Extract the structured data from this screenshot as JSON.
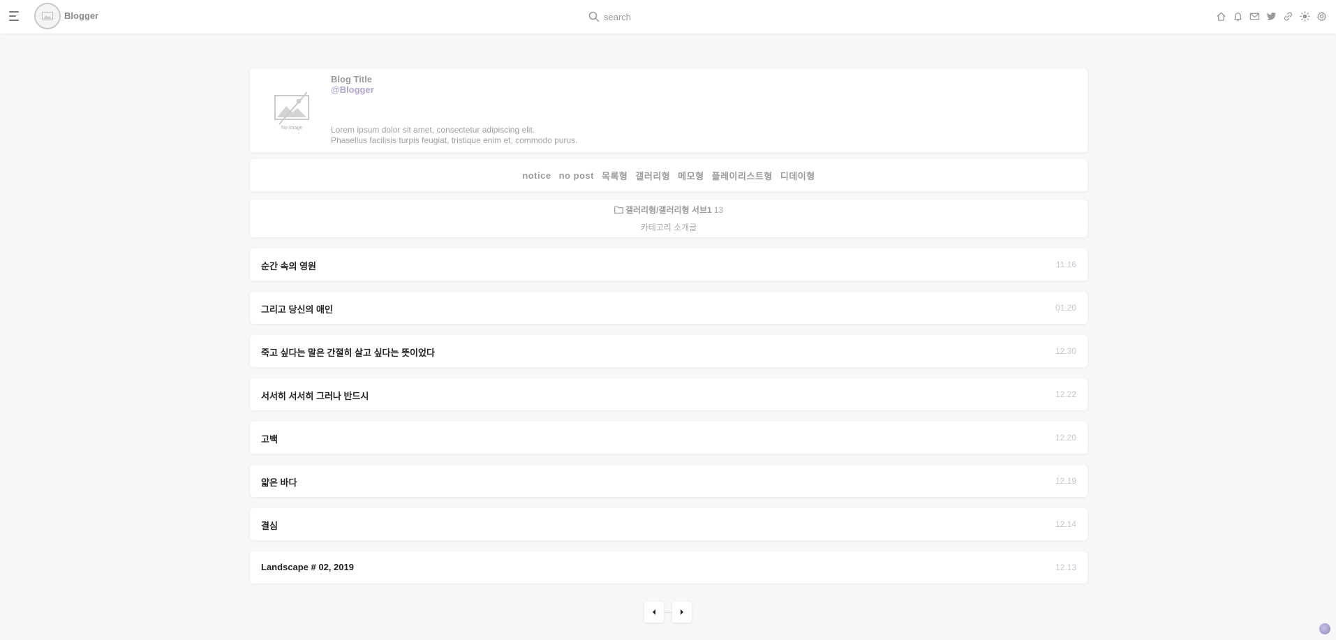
{
  "header": {
    "brand": "Blogger",
    "search_placeholder": "search",
    "icons": [
      "home-icon",
      "bell-icon",
      "mail-icon",
      "twitter-icon",
      "link-icon",
      "sun-icon",
      "gear-icon"
    ]
  },
  "profile": {
    "title": "Blog Title",
    "handle": "@Blogger",
    "no_image_label": "No Image",
    "desc_line1": "Lorem ipsum dolor sit amet, consectetur adipiscing elit.",
    "desc_line2": "Phasellus facilisis turpis feugiat, tristique enim et, commodo purus."
  },
  "categories": [
    "notice",
    "no post",
    "목록형",
    "갤러리형",
    "메모형",
    "플레이리스트형",
    "디데이형"
  ],
  "category_info": {
    "name": "갤러리형/갤러리형 서브1",
    "count": "13",
    "description": "카테고리 소개글"
  },
  "posts": [
    {
      "title": "순간 속의 영원",
      "date": "11.16"
    },
    {
      "title": "그리고 당신의 애인",
      "date": "01.20"
    },
    {
      "title": "죽고 싶다는 말은 간절히 살고 싶다는 뜻이었다",
      "date": "12.30"
    },
    {
      "title": "서서히 서서히 그러나 반드시",
      "date": "12.22"
    },
    {
      "title": "고백",
      "date": "12.20"
    },
    {
      "title": "얇은 바다",
      "date": "12.19"
    },
    {
      "title": "결심",
      "date": "12.14"
    },
    {
      "title": "Landscape # 02, 2019",
      "date": "12.13"
    }
  ],
  "colors": {
    "accent": "#b3a6cc",
    "date": "#c5c5d0",
    "background": "#f6f7f9"
  }
}
